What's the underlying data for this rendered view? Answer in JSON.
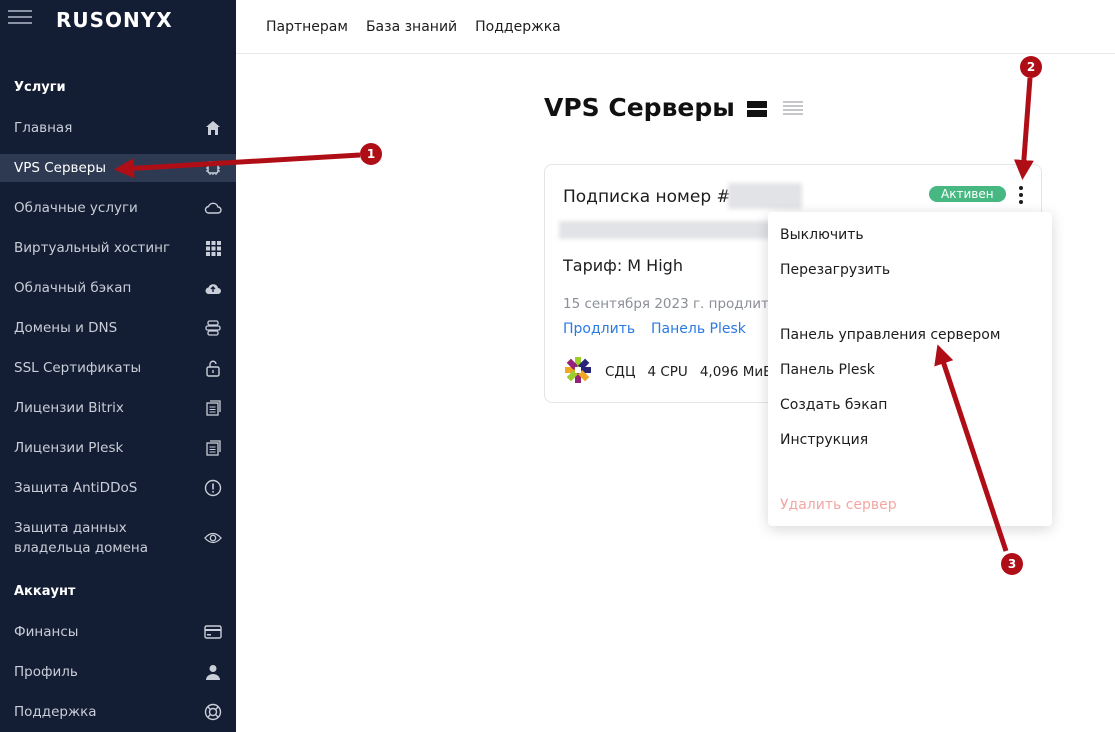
{
  "sidebar": {
    "logo": "RUSONYX",
    "services_title": "Услуги",
    "account_title": "Аккаунт",
    "services": [
      {
        "label": "Главная",
        "icon": "home-icon"
      },
      {
        "label": "VPS Серверы",
        "icon": "chip-icon"
      },
      {
        "label": "Облачные услуги",
        "icon": "cloud-icon"
      },
      {
        "label": "Виртуальный хостинг",
        "icon": "grid-icon"
      },
      {
        "label": "Облачный бэкап",
        "icon": "cloud-upload-icon"
      },
      {
        "label": "Домены и DNS",
        "icon": "dns-icon"
      },
      {
        "label": "SSL Сертификаты",
        "icon": "unlock-icon"
      },
      {
        "label": "Лицензии Bitrix",
        "icon": "license-icon"
      },
      {
        "label": "Лицензии Plesk",
        "icon": "license-icon"
      },
      {
        "label": "Защита AntiDDoS",
        "icon": "alert-icon"
      },
      {
        "label": "Защита данных владельца домена",
        "icon": "eye-icon"
      }
    ],
    "account": [
      {
        "label": "Финансы",
        "icon": "card-icon"
      },
      {
        "label": "Профиль",
        "icon": "user-icon"
      },
      {
        "label": "Поддержка",
        "icon": "lifebuoy-icon"
      }
    ]
  },
  "topbar": {
    "links": [
      "Партнерам",
      "База знаний",
      "Поддержка"
    ]
  },
  "main": {
    "title": "VPS Серверы"
  },
  "card": {
    "title": "Подписка номер #",
    "status": "Активен",
    "status_color": "#47b881",
    "tariff": "Тариф: M High",
    "date": "15 сентября 2023 г. продлится",
    "links": [
      "Продлить",
      "Панель Plesk"
    ],
    "specs": [
      "СДЦ",
      "4 CPU",
      "4,096 МиБ"
    ]
  },
  "dropdown": {
    "items": [
      "Выключить",
      "Перезагрузить",
      "Панель управления сервером",
      "Панель Plesk",
      "Создать бэкап",
      "Инструкция"
    ],
    "danger_item": "Удалить сервер"
  },
  "annotations": {
    "markers": [
      "1",
      "2",
      "3"
    ],
    "color": "#b00e16"
  }
}
